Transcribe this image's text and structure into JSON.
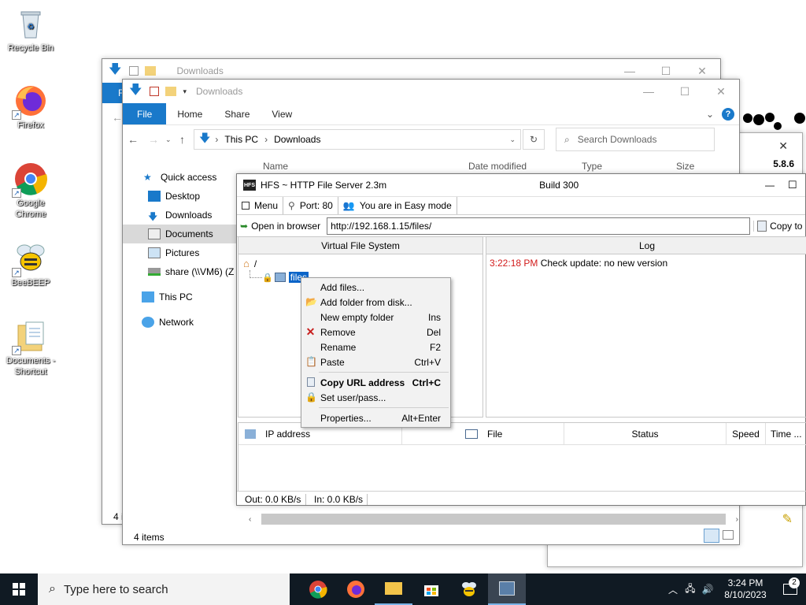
{
  "desktop": {
    "icons": [
      {
        "label": "Recycle Bin"
      },
      {
        "label": "Firefox"
      },
      {
        "label": "Google Chrome"
      },
      {
        "label": "BeeBEEP"
      },
      {
        "label": "Documents - Shortcut"
      }
    ]
  },
  "explorer_back": {
    "title": "Downloads",
    "tab_partial": "Fi",
    "status_partial": "4 i"
  },
  "explorer": {
    "title": "Downloads",
    "ribbon_tabs": [
      "File",
      "Home",
      "Share",
      "View"
    ],
    "breadcrumb": [
      "This PC",
      "Downloads"
    ],
    "search_placeholder": "Search Downloads",
    "columns": [
      "Name",
      "Date modified",
      "Type",
      "Size"
    ],
    "nav": [
      {
        "label": "Quick access"
      },
      {
        "label": "Desktop"
      },
      {
        "label": "Downloads"
      },
      {
        "label": "Documents"
      },
      {
        "label": "Pictures"
      },
      {
        "label": "share (\\\\VM6) (Z"
      },
      {
        "label": "This PC"
      },
      {
        "label": "Network"
      }
    ],
    "status": "4 items"
  },
  "third_window": {
    "version": "5.8.6"
  },
  "hfs": {
    "title": "HFS ~ HTTP File Server 2.3m",
    "build": "Build 300",
    "toolbar": {
      "menu": "Menu",
      "port": "Port: 80",
      "mode": "You are in Easy mode"
    },
    "open_in_browser": "Open in browser",
    "url": "http://192.168.1.15/files/",
    "copy_to": "Copy to",
    "vfs_header": "Virtual File System",
    "log_header": "Log",
    "tree_root": "/",
    "tree_item": "files",
    "log_time": "3:22:18 PM",
    "log_message": "Check update: no new version",
    "conn_columns": [
      "IP address",
      "File",
      "Status",
      "Speed",
      "Time ..."
    ],
    "out_speed": "Out: 0.0 KB/s",
    "in_speed": "In: 0.0 KB/s"
  },
  "context_menu": [
    {
      "label": "Add files...",
      "shortcut": "",
      "icon": "none"
    },
    {
      "label": "Add folder from disk...",
      "shortcut": "",
      "icon": "folder-icon"
    },
    {
      "label": "New empty folder",
      "shortcut": "Ins",
      "icon": "none"
    },
    {
      "label": "Remove",
      "shortcut": "Del",
      "icon": "red-x-icon"
    },
    {
      "label": "Rename",
      "shortcut": "F2",
      "icon": "none"
    },
    {
      "label": "Paste",
      "shortcut": "Ctrl+V",
      "icon": "paste-icon"
    },
    {
      "label": "Copy URL address",
      "shortcut": "Ctrl+C",
      "icon": "copy-icon",
      "bold": true
    },
    {
      "label": "Set user/pass...",
      "shortcut": "",
      "icon": "lock-icon"
    },
    {
      "label": "Properties...",
      "shortcut": "Alt+Enter",
      "icon": "none"
    }
  ],
  "taskbar": {
    "search_placeholder": "Type here to search",
    "time": "3:24 PM",
    "date": "8/10/2023",
    "notification_count": "2"
  }
}
